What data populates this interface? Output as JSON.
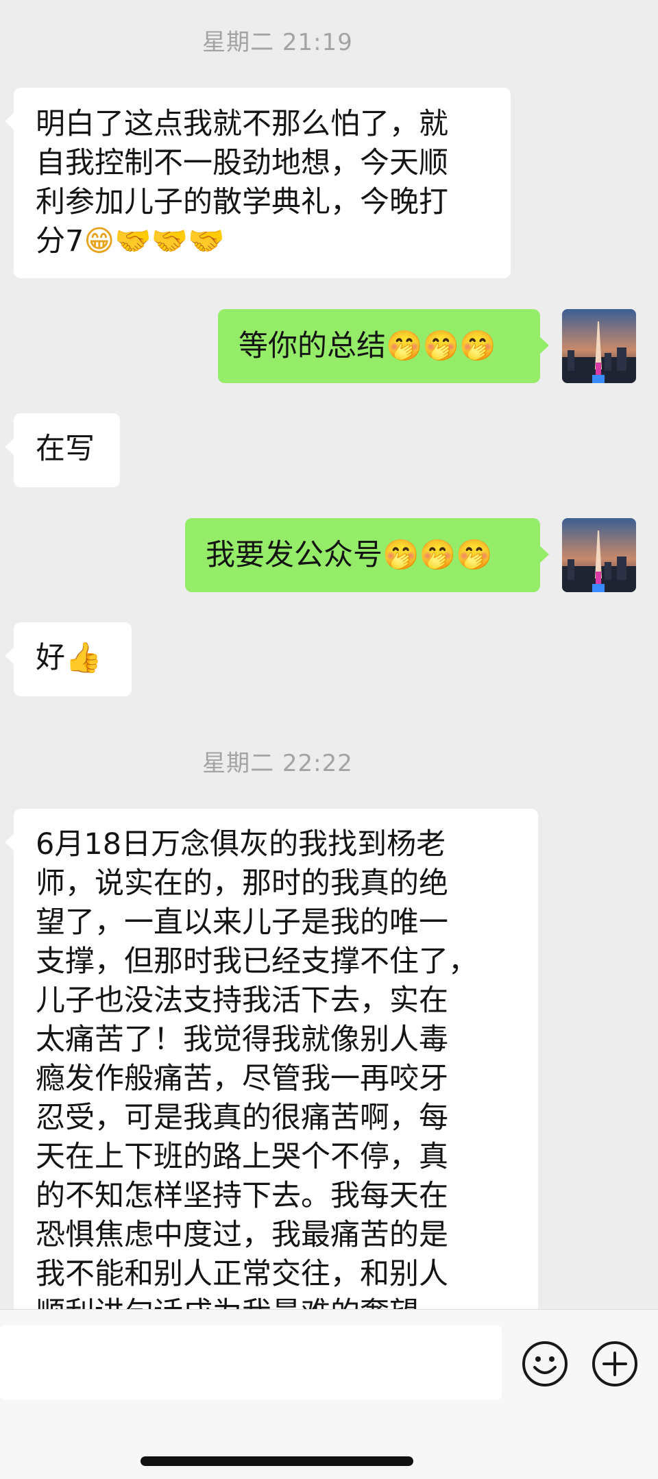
{
  "chat": {
    "timestamps": [
      "星期二 21:19",
      "星期二 22:22"
    ],
    "messages": [
      {
        "side": "left",
        "lines": [
          "明白了这点我就不那么怕了，就",
          "自我控制不一股劲地想，今天顺",
          "利参加儿子的散学典礼，今晚打",
          "分7"
        ],
        "emoji": "😁🤝🤝🤝"
      },
      {
        "side": "right",
        "text": "等你的总结",
        "emoji": "🤭🤭🤭"
      },
      {
        "side": "left",
        "text": "在写"
      },
      {
        "side": "right",
        "text": "我要发公众号",
        "emoji": "🤭🤭🤭"
      },
      {
        "side": "left",
        "text": "好",
        "emoji": "👍"
      },
      {
        "side": "left",
        "lines": [
          "6月18日万念俱灰的我找到杨老",
          "师，说实在的，那时的我真的绝",
          "望了，一直以来儿子是我的唯一",
          "支撑，但那时我已经支撑不住了，",
          "儿子也没法支持我活下去，实在",
          "太痛苦了！我觉得我就像别人毒",
          "瘾发作般痛苦，尽管我一再咬牙",
          "忍受，可是我真的很痛苦啊，每",
          "天在上下班的路上哭个不停，真",
          "的不知怎样坚持下去。我每天在",
          "恐惧焦虑中度过，我最痛苦的是",
          "我不能和别人正常交往，和别人",
          "顺利讲句话成为我最难的奢望"
        ]
      }
    ]
  },
  "input_bar": {
    "value": "",
    "placeholder": "",
    "emoji_icon": "smiley-icon",
    "plus_icon": "plus-icon"
  },
  "colors": {
    "background": "#ededed",
    "sent_bubble": "#95ec69",
    "received_bubble": "#ffffff",
    "timestamp": "#a3a3a3"
  }
}
